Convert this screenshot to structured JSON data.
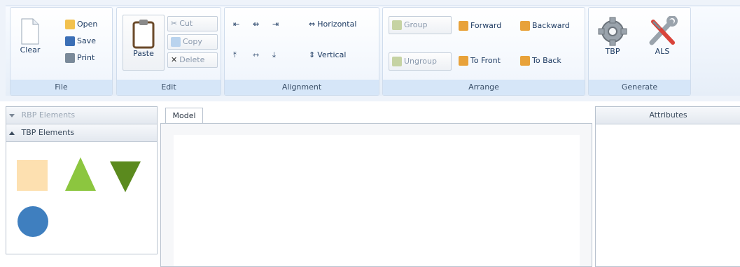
{
  "ribbon": {
    "file": {
      "label": "File",
      "clear": "Clear",
      "open": "Open",
      "save": "Save",
      "print": "Print"
    },
    "edit": {
      "label": "Edit",
      "paste": "Paste",
      "cut": "Cut",
      "copy": "Copy",
      "delete": "Delete"
    },
    "alignment": {
      "label": "Alignment",
      "horizontal": "Horizontal",
      "vertical": "Vertical"
    },
    "arrange": {
      "label": "Arrange",
      "group": "Group",
      "ungroup": "Ungroup",
      "forward": "Forward",
      "backward": "Backward",
      "to_front": "To Front",
      "to_back": "To Back"
    },
    "generate": {
      "label": "Generate",
      "tbp": "TBP",
      "als": "ALS"
    }
  },
  "left_pane": {
    "rbp_header": "RBP Elements",
    "tbp_header": "TBP Elements",
    "shapes": [
      {
        "name": "square",
        "color": "#fde0b0"
      },
      {
        "name": "triangle-up",
        "color": "#8cc63f"
      },
      {
        "name": "triangle-down",
        "color": "#5b8a1e"
      },
      {
        "name": "circle",
        "color": "#3f7fbf"
      }
    ]
  },
  "model": {
    "tab_label": "Model"
  },
  "attributes": {
    "header": "Attributes"
  }
}
